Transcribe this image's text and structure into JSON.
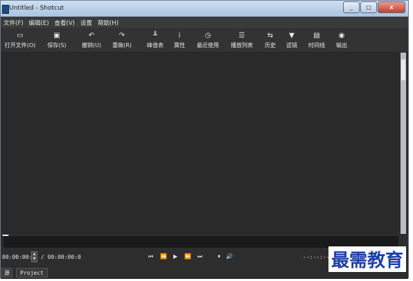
{
  "window": {
    "title": "Untitled - Shotcut",
    "minimize": "_",
    "maximize": "□",
    "close": "x"
  },
  "menu": [
    {
      "label": "文件(F)"
    },
    {
      "label": "编辑(E)"
    },
    {
      "label": "查看(V)"
    },
    {
      "label": "设置"
    },
    {
      "label": "帮助(H)"
    }
  ],
  "toolbar": [
    {
      "icon": "open-icon",
      "glyph": "▭",
      "label": "打开文件(O)"
    },
    {
      "icon": "save-icon",
      "glyph": "▣",
      "label": "保存(S)"
    },
    {
      "icon": "undo-icon",
      "glyph": "↶",
      "label": "撤销(U)"
    },
    {
      "icon": "redo-icon",
      "glyph": "↷",
      "label": "重做(R)"
    },
    {
      "icon": "peak-meter-icon",
      "glyph": "╨",
      "label": "峰值表"
    },
    {
      "icon": "info-icon",
      "glyph": "i",
      "label": "属性"
    },
    {
      "icon": "clock-icon",
      "glyph": "◷",
      "label": "最近使用"
    },
    {
      "icon": "playlist-icon",
      "glyph": "☰",
      "label": "播放列表"
    },
    {
      "icon": "history-icon",
      "glyph": "⇆",
      "label": "历史"
    },
    {
      "icon": "filter-icon",
      "glyph": "▼",
      "label": "滤镜"
    },
    {
      "icon": "timeline-icon",
      "glyph": "▤",
      "label": "时间线"
    },
    {
      "icon": "export-icon",
      "glyph": "◉",
      "label": "输出"
    }
  ],
  "transport": {
    "position": "00:00:00:(",
    "duration": "/ 00:00:00:0",
    "skip_start": "⏮",
    "rewind": "⏪",
    "play": "▶",
    "forward": "⏩",
    "skip_end": "⏭",
    "volume_menu": "▾",
    "volume": "🔊",
    "inout_readout": "--:--:--:-"
  },
  "tabs": {
    "source": "源",
    "project": "Project"
  },
  "watermark": "最需教育"
}
